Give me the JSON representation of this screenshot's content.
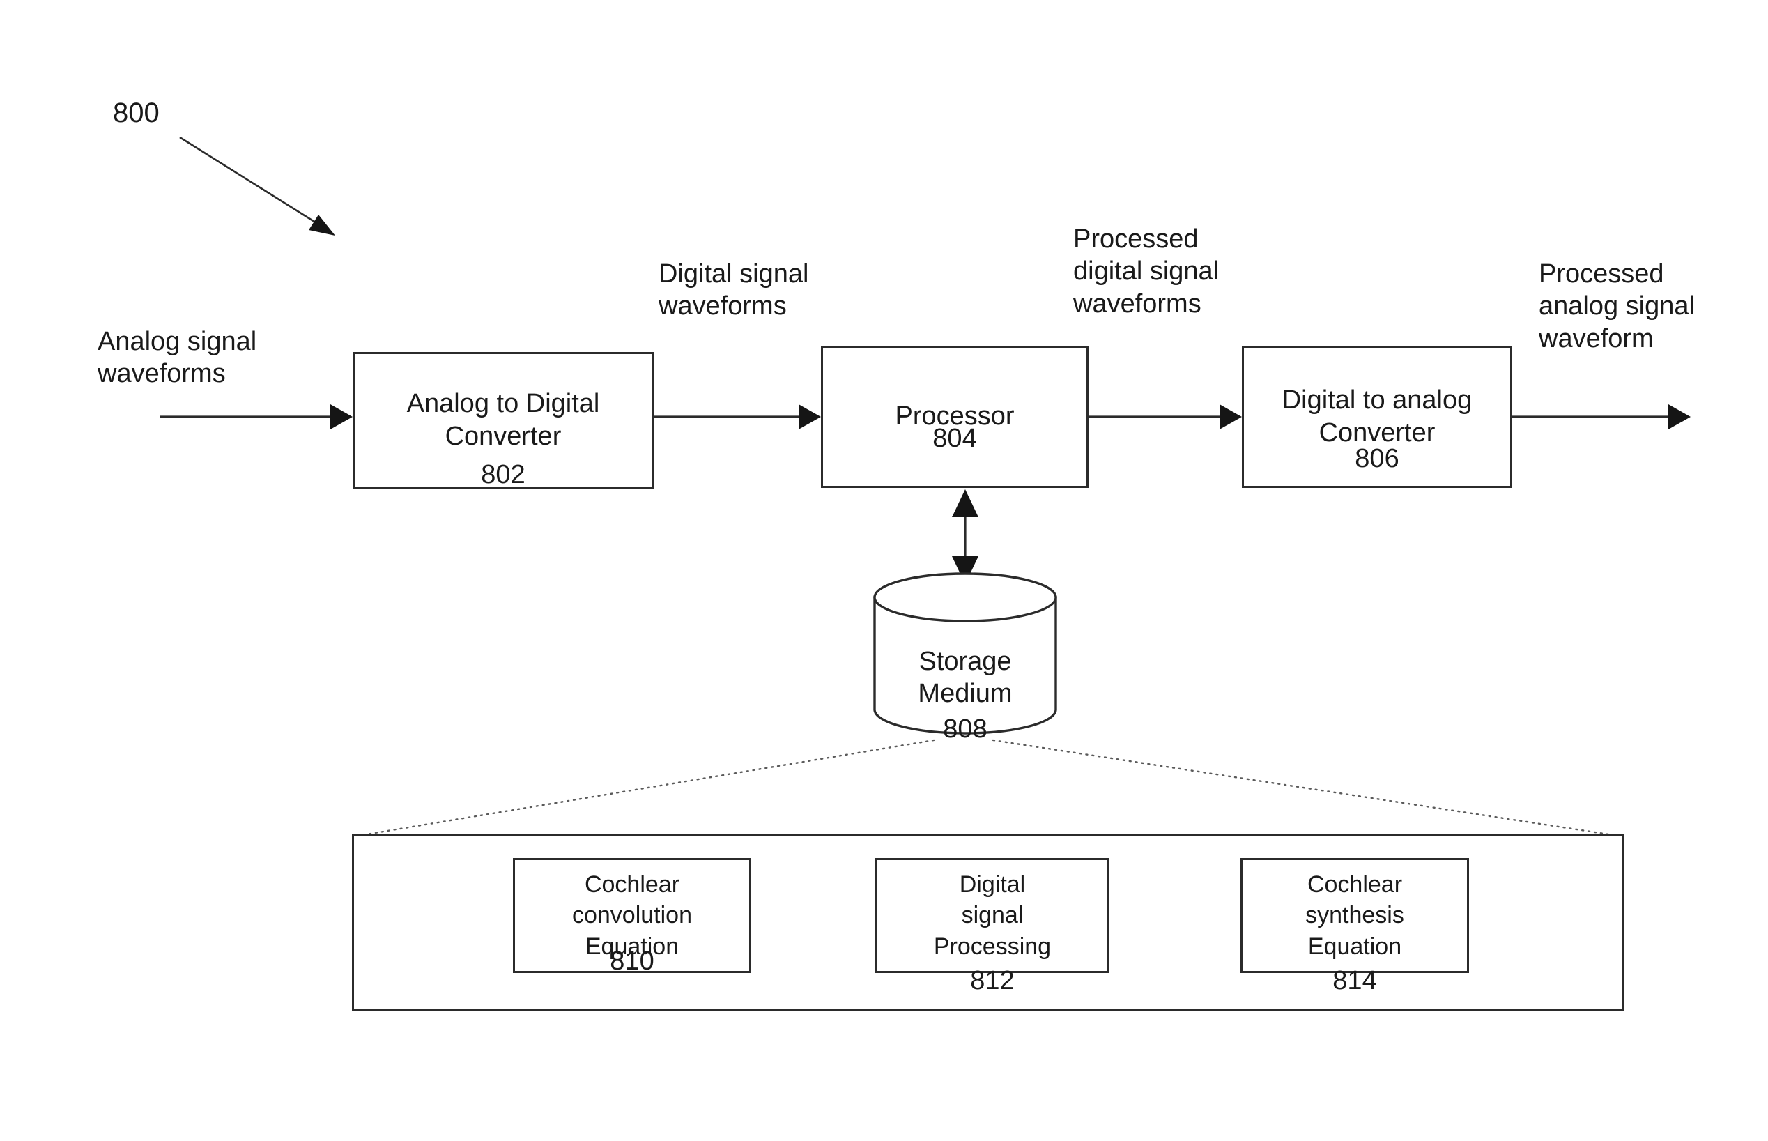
{
  "figure": {
    "number": "800"
  },
  "labels": {
    "input_signal": "Analog signal\nwaveforms",
    "digital_signal": "Digital signal\nwaveforms",
    "processed_digital_signal": "Processed\ndigital signal\nwaveforms",
    "processed_analog_signal": "Processed\nanalog signal\nwaveform"
  },
  "blocks": {
    "adc": {
      "title": "Analog to Digital\nConverter",
      "number": "802"
    },
    "processor": {
      "title": "Processor",
      "number": "804"
    },
    "dac": {
      "title": "Digital to analog\nConverter",
      "number": "806"
    },
    "storage": {
      "title": "Storage\nMedium",
      "number": "808"
    }
  },
  "detail_panel": {
    "blocks": [
      {
        "title": "Cochlear\nconvolution\nEquation",
        "number": "810"
      },
      {
        "title": "Digital\nsignal\nProcessing",
        "number": "812"
      },
      {
        "title": "Cochlear\nsynthesis\nEquation",
        "number": "814"
      }
    ]
  },
  "colors": {
    "ink": "#1a1a1a",
    "stroke": "#2b2b2b",
    "callout": "#5a5a5a",
    "background": "#ffffff"
  }
}
